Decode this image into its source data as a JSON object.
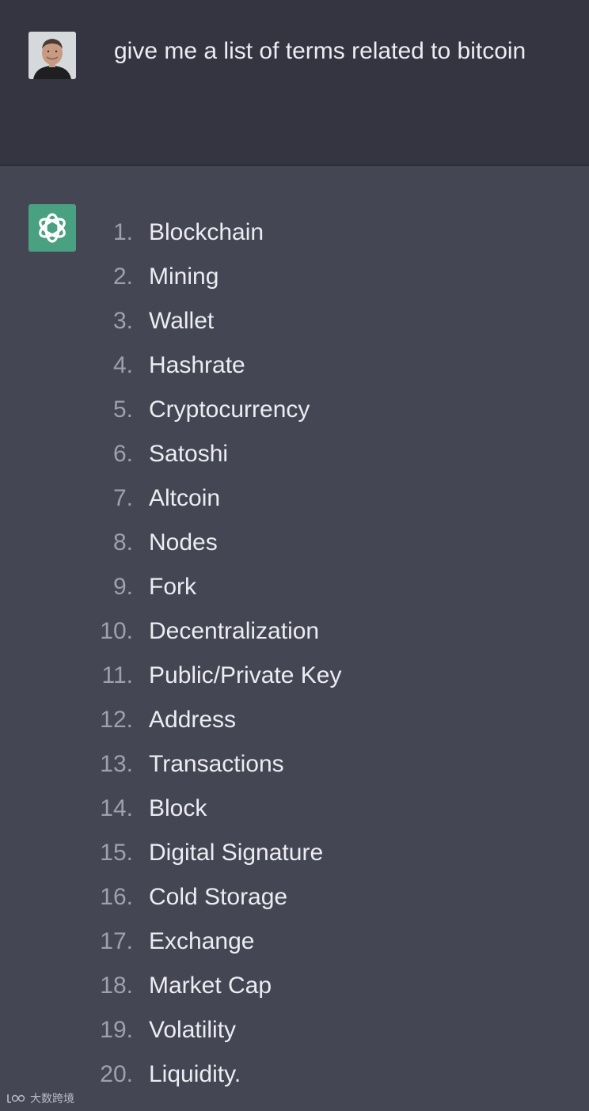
{
  "user_message": {
    "text": "give me a list of terms related to bitcoin"
  },
  "assistant_message": {
    "items": [
      {
        "number": "1.",
        "term": "Blockchain"
      },
      {
        "number": "2.",
        "term": "Mining"
      },
      {
        "number": "3.",
        "term": "Wallet"
      },
      {
        "number": "4.",
        "term": "Hashrate"
      },
      {
        "number": "5.",
        "term": "Cryptocurrency"
      },
      {
        "number": "6.",
        "term": "Satoshi"
      },
      {
        "number": "7.",
        "term": "Altcoin"
      },
      {
        "number": "8.",
        "term": "Nodes"
      },
      {
        "number": "9.",
        "term": "Fork"
      },
      {
        "number": "10.",
        "term": "Decentralization"
      },
      {
        "number": "11.",
        "term": "Public/Private Key"
      },
      {
        "number": "12.",
        "term": "Address"
      },
      {
        "number": "13.",
        "term": "Transactions"
      },
      {
        "number": "14.",
        "term": "Block"
      },
      {
        "number": "15.",
        "term": "Digital Signature"
      },
      {
        "number": "16.",
        "term": "Cold Storage"
      },
      {
        "number": "17.",
        "term": "Exchange"
      },
      {
        "number": "18.",
        "term": "Market Cap"
      },
      {
        "number": "19.",
        "term": "Volatility"
      },
      {
        "number": "20.",
        "term": "Liquidity."
      }
    ]
  },
  "watermark": {
    "text": "大数跨境"
  },
  "icons": {
    "user_avatar": "user-avatar-photo",
    "assistant_avatar": "openai-logo-icon"
  },
  "colors": {
    "user_row_bg": "#343541",
    "assistant_row_bg": "#444654",
    "assistant_avatar_bg": "#4aa181",
    "text": "#ececf1",
    "number_text": "#9ea0ab"
  }
}
